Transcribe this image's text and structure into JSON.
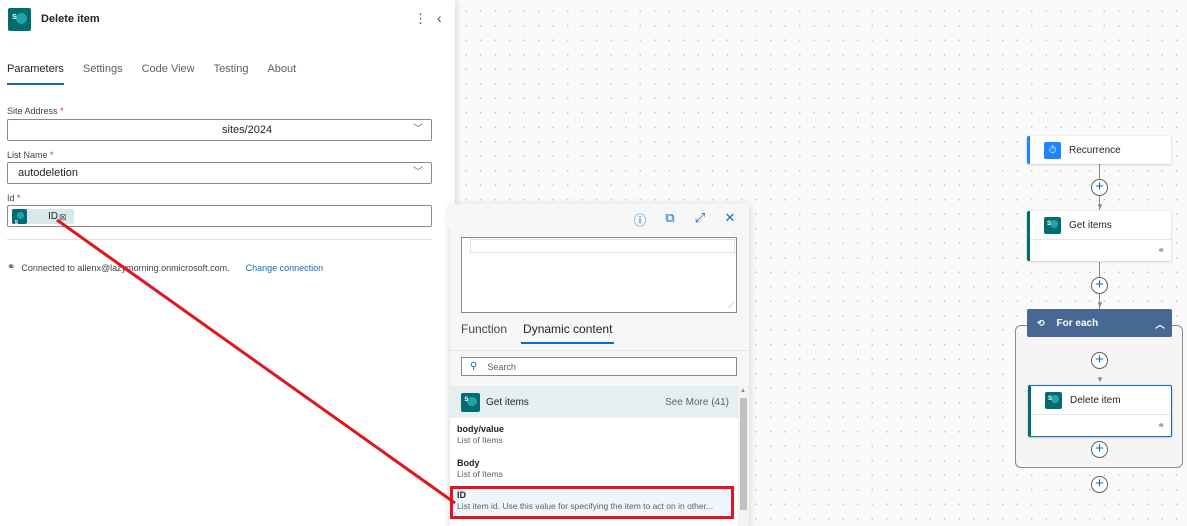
{
  "panel": {
    "title": "Delete item",
    "more_icon": "⋮",
    "collapse_icon": "‹",
    "tabs": [
      {
        "label": "Parameters",
        "active": true
      },
      {
        "label": "Settings",
        "active": false
      },
      {
        "label": "Code View",
        "active": false
      },
      {
        "label": "Testing",
        "active": false
      },
      {
        "label": "About",
        "active": false
      }
    ],
    "fields": {
      "site_address": {
        "label": "Site Address",
        "required": "*",
        "value": "sites/2024"
      },
      "list_name": {
        "label": "List Name",
        "required": "*",
        "value": "autodeletion"
      },
      "id": {
        "label": "Id",
        "required": "*",
        "token_label": "ID"
      }
    },
    "connection": {
      "text": "Connected to allenx@lazymorning.onmicrosoft.com.",
      "change_link": "Change connection"
    }
  },
  "popup": {
    "tabs": [
      {
        "label": "Function",
        "active": false
      },
      {
        "label": "Dynamic content",
        "active": true
      }
    ],
    "search_placeholder": "Search",
    "group": {
      "title": "Get items",
      "see_more": "See More (41)"
    },
    "items": [
      {
        "title": "body/value",
        "desc": "List of Items",
        "highlighted": false
      },
      {
        "title": "Body",
        "desc": "List of Items",
        "highlighted": false
      },
      {
        "title": "ID",
        "desc": "List item id. Use this value for specifying the item to act on in other...",
        "highlighted": true
      }
    ]
  },
  "flow": {
    "nodes": [
      {
        "title": "Recurrence",
        "accent": "#1f85ff"
      },
      {
        "title": "Get items",
        "accent": "#036c70"
      },
      {
        "title": "For each",
        "accent": "#476892"
      },
      {
        "title": "Delete item",
        "accent": "#036c70"
      }
    ]
  },
  "annotation_color": "#e0161e"
}
